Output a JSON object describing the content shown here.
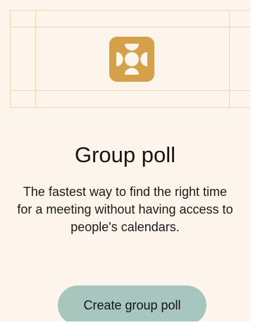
{
  "card": {
    "title": "Group poll",
    "description_lines": [
      "The fastest way to find the right time",
      "for a meeting without having access to",
      "people's calendars."
    ],
    "button_label": "Create group poll",
    "logo_icon": "group-poll-logo-icon"
  },
  "colors": {
    "card_background": "#fdf5ec",
    "grid_lines": "#efd9b3",
    "logo_gold": "#d4a04a",
    "logo_center": "#fdf5ec",
    "button_background": "#a7c6bd",
    "text": "#141414"
  }
}
